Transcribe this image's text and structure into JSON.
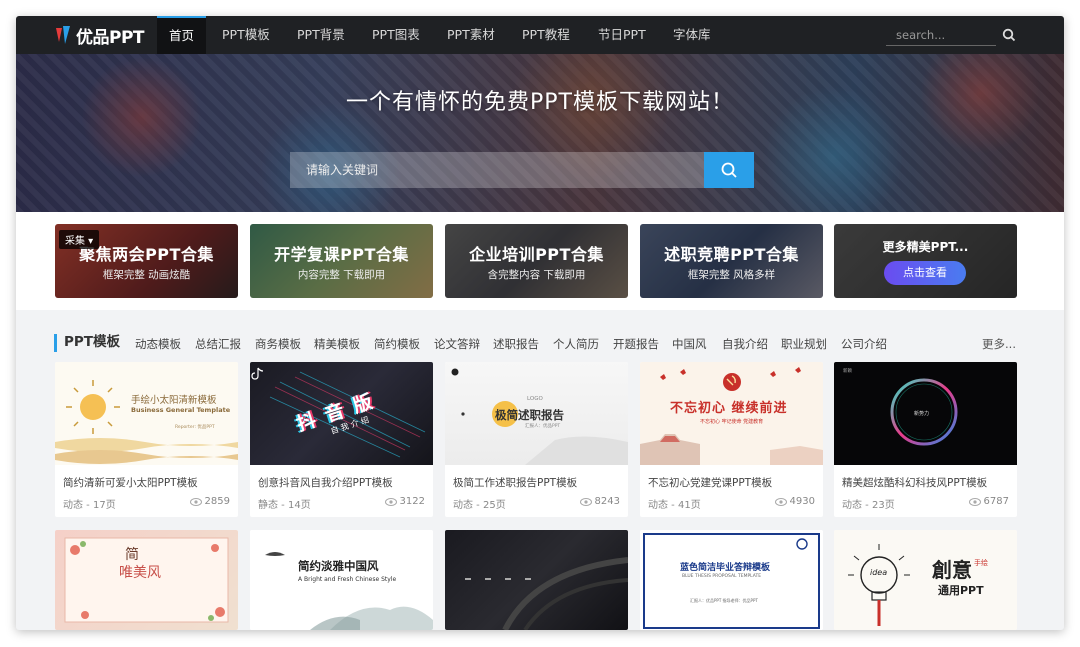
{
  "nav": {
    "logo": "优品PPT",
    "items": [
      "首页",
      "PPT模板",
      "PPT背景",
      "PPT图表",
      "PPT素材",
      "PPT教程",
      "节日PPT",
      "字体库"
    ],
    "search_placeholder": "search..."
  },
  "hero": {
    "title": "一个有情怀的免费PPT模板下载网站！",
    "search_placeholder": "请输入关键词"
  },
  "collections": [
    {
      "title": "聚焦两会PPT合集",
      "sub": "框架完整   动画炫酷",
      "tag": "采集"
    },
    {
      "title": "开学复课PPT合集",
      "sub": "内容完整   下载即用"
    },
    {
      "title": "企业培训PPT合集",
      "sub": "含完整内容   下载即用"
    },
    {
      "title": "述职竞聘PPT合集",
      "sub": "框架完整   风格多样"
    }
  ],
  "collections_more": {
    "title": "更多精美PPT...",
    "button": "点击查看"
  },
  "category": {
    "head": "PPT模板",
    "items": [
      "动态模板",
      "总结汇报",
      "商务模板",
      "精美模板",
      "简约模板",
      "论文答辩",
      "述职报告",
      "个人简历",
      "开题报告",
      "中国风",
      "自我介绍",
      "职业规划",
      "公司介绍"
    ],
    "more": "更多..."
  },
  "cards": [
    {
      "title": "简约清新可爱小太阳PPT模板",
      "meta": "动态 - 17页",
      "views": "2859"
    },
    {
      "title": "创意抖音风自我介绍PPT模板",
      "meta": "静态 - 14页",
      "views": "3122"
    },
    {
      "title": "极简工作述职报告PPT模板",
      "meta": "动态 - 25页",
      "views": "8243"
    },
    {
      "title": "不忘初心党建党课PPT模板",
      "meta": "动态 - 41页",
      "views": "4930"
    },
    {
      "title": "精美超炫酷科幻科技风PPT模板",
      "meta": "动态 - 23页",
      "views": "6787"
    }
  ],
  "thumbs": {
    "t1_title": "手绘小太阳清新模板",
    "t1_sub": "Business General Template",
    "t1_reporter": "Reporter: 优品PPT",
    "t2_big": "抖 音 版",
    "t2_sub": "自 我 介 绍",
    "t3_logo": "LOGO",
    "t3_title": "极简述职报告",
    "t3_sub": "汇报人：优品PPT",
    "t4_title": "不忘初心 继续前进",
    "t4_sub": "不忘初心 牢记使命 党建教育",
    "t5_label": "新颖",
    "t5_sub": "新势力",
    "r2_1_title": "简",
    "r2_1_big": "唯美风",
    "r2_2_title": "简约淡雅中国风",
    "r2_2_sub": "A Bright and Fresh Chinese Style",
    "r2_4_title": "蓝色简洁毕业答辩模板",
    "r2_4_sub": "BLUE THESIS PROPOSAL TEMPLATE",
    "r2_4_foot": "汇报人：优品PPT    指导老师：优品PPT",
    "r2_5_a": "創意",
    "r2_5_b": "手绘",
    "r2_5_c": "通用PPT",
    "r2_5_idea": "idea"
  }
}
